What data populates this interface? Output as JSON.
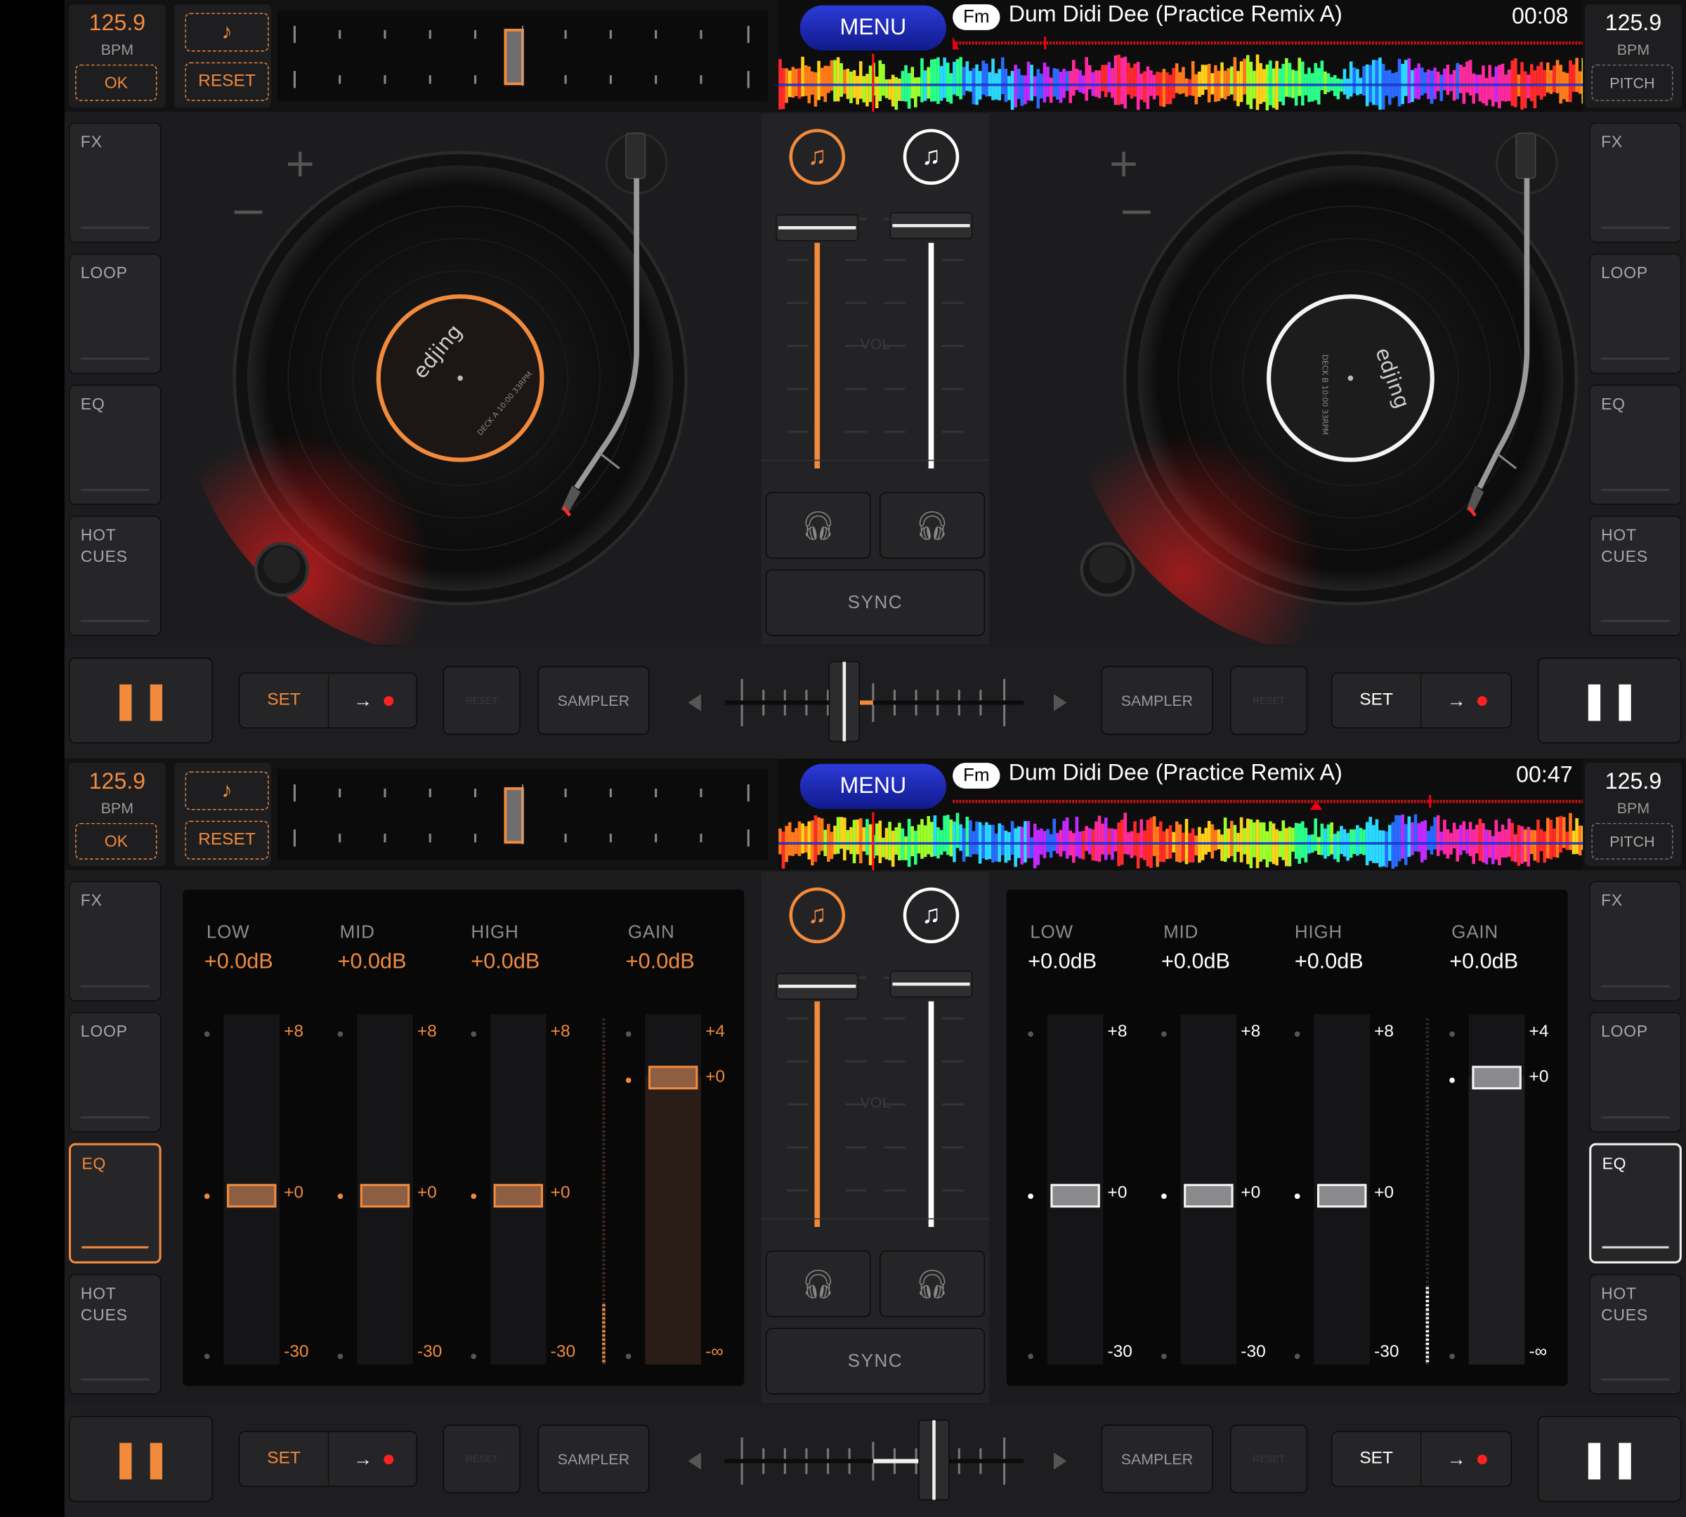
{
  "app": {
    "name": "edjing"
  },
  "top": {
    "deck_a": {
      "bpm_value": "125.9",
      "bpm_unit": "BPM",
      "ok_label": "OK",
      "reset_label": "RESET",
      "record_label": "edjing",
      "record_sub": "DECK A 10:00 33RPM",
      "accent": "#f28a3c"
    },
    "deck_b": {
      "bpm_value": "125.9",
      "bpm_unit": "BPM",
      "pitch_label": "PITCH",
      "record_label": "edjing",
      "record_sub": "DECK B 10:00 33RPM",
      "accent": "#ffffff"
    },
    "header": {
      "menu_label": "MENU",
      "key_badge": "Fm",
      "track_title": "Dum Didi Dee (Practice Remix A)",
      "time": "00:08",
      "progress": 0.17
    },
    "sidebar_left": [
      "FX",
      "LOOP",
      "EQ",
      "HOT CUES"
    ],
    "sidebar_right": [
      "FX",
      "LOOP",
      "EQ",
      "HOT CUES"
    ],
    "mixer": {
      "vol_label": "VOL",
      "sync_label": "SYNC",
      "left_icon": "music-note-add-icon",
      "right_icon": "music-note-add-icon",
      "headphone_icon": "headphones-icon"
    },
    "bottom": {
      "left": {
        "set_label": "SET",
        "reset_label": "RESET",
        "sampler_label": "SAMPLER"
      },
      "right": {
        "set_label": "SET",
        "reset_label": "RESET",
        "sampler_label": "SAMPLER"
      },
      "crossfader": 0.4
    }
  },
  "bottom_panel": {
    "deck_a": {
      "bpm_value": "125.9",
      "bpm_unit": "BPM",
      "ok_label": "OK",
      "reset_label": "RESET"
    },
    "deck_b": {
      "bpm_value": "125.9",
      "bpm_unit": "BPM",
      "pitch_label": "PITCH"
    },
    "header": {
      "menu_label": "MENU",
      "key_badge": "Fm",
      "track_title": "Dum Didi Dee (Practice Remix A)",
      "time": "00:47",
      "progress": 0.6
    },
    "sidebar_left": [
      "FX",
      "LOOP",
      "EQ",
      "HOT CUES"
    ],
    "sidebar_right": [
      "FX",
      "LOOP",
      "EQ",
      "HOT CUES"
    ],
    "active_sidebar": "EQ",
    "mixer": {
      "vol_label": "VOL",
      "sync_label": "SYNC"
    },
    "eq_left": {
      "bands": [
        {
          "label": "LOW",
          "value": "+0.0dB",
          "top": "+8",
          "mid": "+0",
          "bottom": "-30"
        },
        {
          "label": "MID",
          "value": "+0.0dB",
          "top": "+8",
          "mid": "+0",
          "bottom": "-30"
        },
        {
          "label": "HIGH",
          "value": "+0.0dB",
          "top": "+8",
          "mid": "+0",
          "bottom": "-30"
        },
        {
          "label": "GAIN",
          "value": "+0.0dB",
          "top": "+4",
          "mid": "+0",
          "bottom": "-∞"
        }
      ]
    },
    "eq_right": {
      "bands": [
        {
          "label": "LOW",
          "value": "+0.0dB",
          "top": "+8",
          "mid": "+0",
          "bottom": "-30"
        },
        {
          "label": "MID",
          "value": "+0.0dB",
          "top": "+8",
          "mid": "+0",
          "bottom": "-30"
        },
        {
          "label": "HIGH",
          "value": "+0.0dB",
          "top": "+8",
          "mid": "+0",
          "bottom": "-30"
        },
        {
          "label": "GAIN",
          "value": "+0.0dB",
          "top": "+4",
          "mid": "+0",
          "bottom": "-∞"
        }
      ]
    },
    "bottom": {
      "left": {
        "set_label": "SET",
        "reset_label": "RESET",
        "sampler_label": "SAMPLER"
      },
      "right": {
        "set_label": "SET",
        "reset_label": "RESET",
        "sampler_label": "SAMPLER"
      },
      "crossfader": 0.7
    }
  }
}
